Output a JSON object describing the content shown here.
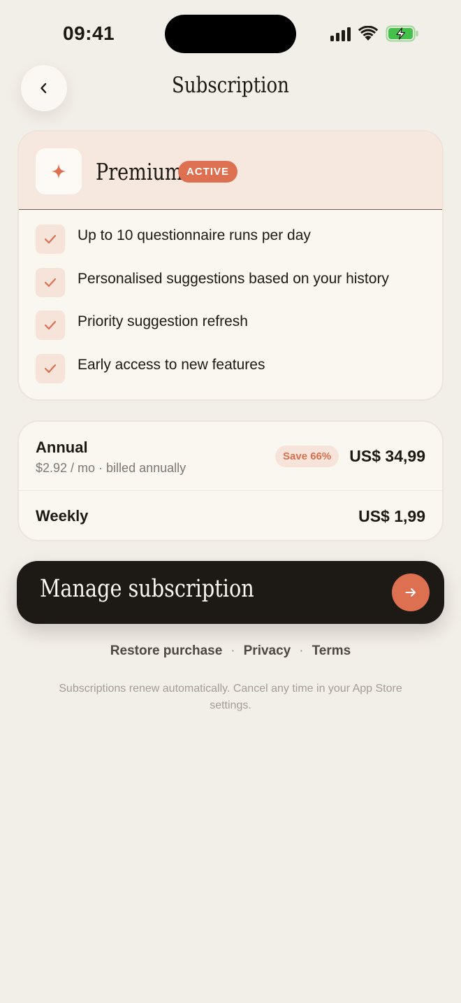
{
  "status_bar": {
    "time": "09:41"
  },
  "header": {
    "title": "Subscription"
  },
  "plan": {
    "name": "Premium",
    "badge": "ACTIVE",
    "features": [
      "Up to 10 questionnaire runs per day",
      "Personalised suggestions based on your history",
      "Priority suggestion refresh",
      "Early access to new features"
    ]
  },
  "pricing": {
    "annual": {
      "label": "Annual",
      "subtitle": "$2.92 / mo · billed annually",
      "badge": "Save 66%",
      "price": "US$ 34,99"
    },
    "weekly": {
      "label": "Weekly",
      "price": "US$ 1,99"
    }
  },
  "actions": {
    "manage_label": "Manage subscription"
  },
  "links": {
    "restore": "Restore purchase",
    "privacy": "Privacy",
    "terms": "Terms",
    "separator": "·"
  },
  "footnote": "Subscriptions renew automatically. Cancel any time in your App Store settings.",
  "colors": {
    "accent": "#de7052",
    "background": "#f2eee8",
    "dark_button": "#1d1915",
    "battery": "#45c04a"
  },
  "icons": [
    "back-chevron-icon",
    "sparkle-icon",
    "check-icon",
    "arrow-right-icon",
    "signal-icon",
    "wifi-icon",
    "battery-icon"
  ]
}
